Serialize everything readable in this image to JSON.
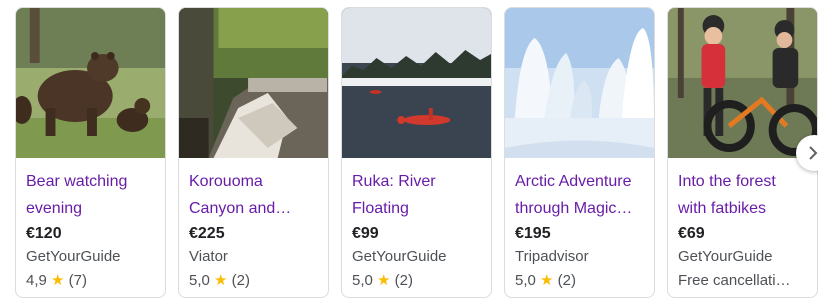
{
  "cards": [
    {
      "title_line1": "Bear watching",
      "title_line2": "evening",
      "price": "€120",
      "source": "GetYourGuide",
      "rating_value": "4,9",
      "rating_count": "(7)",
      "image_icon": "bear-photo"
    },
    {
      "title_line1": "Korouoma",
      "title_line2": "Canyon and…",
      "price": "€225",
      "source": "Viator",
      "rating_value": "5,0",
      "rating_count": "(2)",
      "image_icon": "canyon-photo"
    },
    {
      "title_line1": "Ruka: River",
      "title_line2": "Floating",
      "price": "€99",
      "source": "GetYourGuide",
      "rating_value": "5,0",
      "rating_count": "(2)",
      "image_icon": "river-floating-photo"
    },
    {
      "title_line1": "Arctic Adventure",
      "title_line2": "through Magic…",
      "price": "€195",
      "source": "Tripadvisor",
      "rating_value": "5,0",
      "rating_count": "(2)",
      "image_icon": "snowy-forest-photo"
    },
    {
      "title_line1": "Into the forest",
      "title_line2": "with fatbikes",
      "price": "€69",
      "source": "GetYourGuide",
      "extra": "Free cancellati…",
      "image_icon": "fatbike-photo"
    }
  ],
  "star_glyph": "★",
  "next_icon": "chevron-right-icon",
  "colors": {
    "title": "#681da8",
    "star": "#fbbc04",
    "secondary_text": "#4d5156",
    "border": "#dadce0"
  }
}
